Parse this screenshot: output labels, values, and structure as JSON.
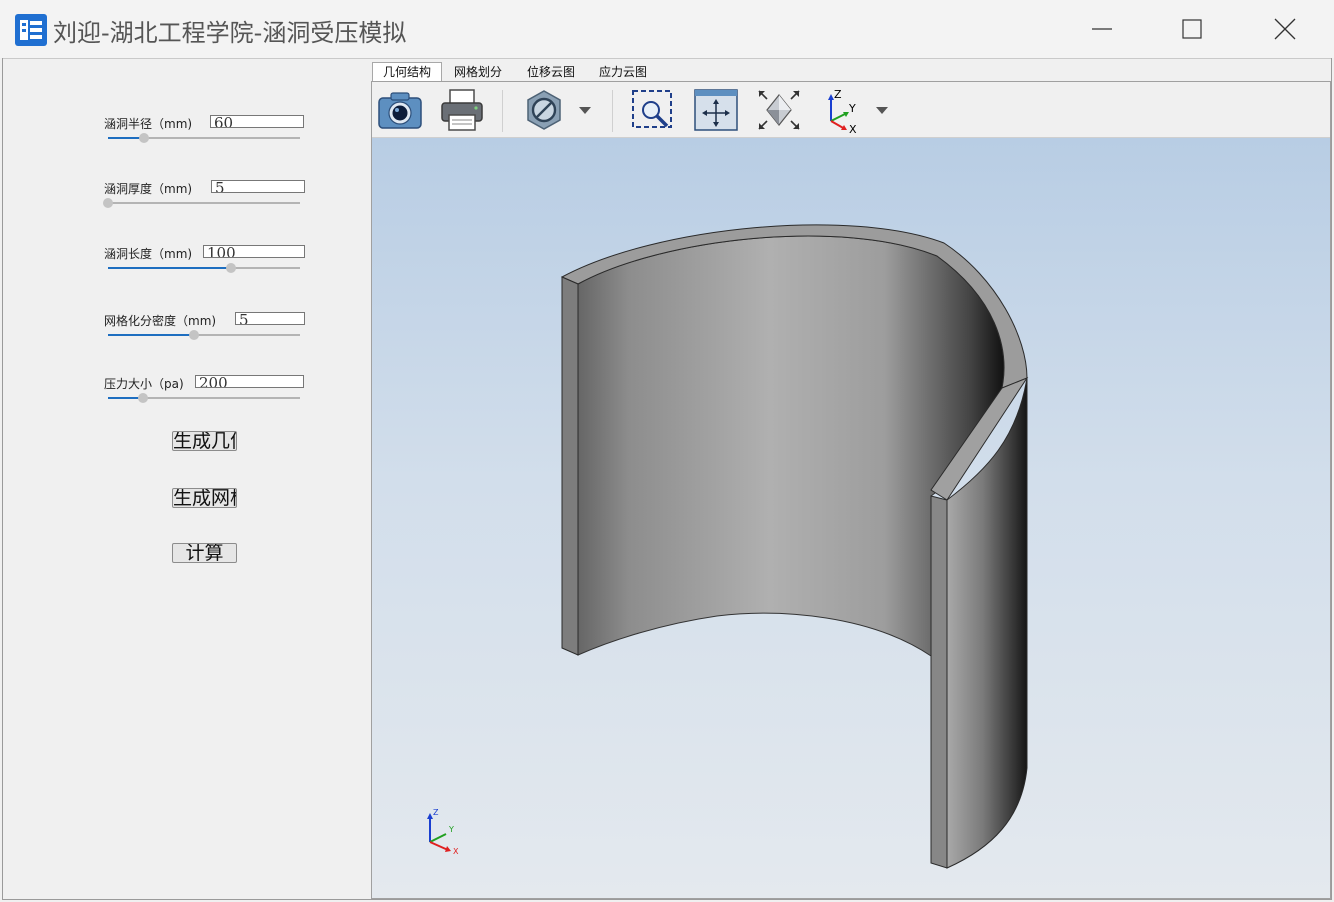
{
  "window": {
    "title": "刘迎-湖北工程学院-涵洞受压模拟"
  },
  "params": [
    {
      "label": "涵洞半径（mm)",
      "value": "60",
      "slider_fraction": 0.19
    },
    {
      "label": "涵洞厚度（mm)",
      "value": "5",
      "slider_fraction": 0.0
    },
    {
      "label": "涵洞长度（mm)",
      "value": "100",
      "slider_fraction": 0.64
    },
    {
      "label": "网格化分密度（mm)",
      "value": "5",
      "slider_fraction": 0.45
    },
    {
      "label": "压力大小（pa)",
      "value": "200",
      "slider_fraction": 0.18
    }
  ],
  "buttons": {
    "generate_geometry": "生成几何",
    "generate_mesh": "生成网格",
    "calculate": "计算"
  },
  "tabs": [
    {
      "label": "几何结构",
      "active": true
    },
    {
      "label": "网格划分",
      "active": false
    },
    {
      "label": "位移云图",
      "active": false
    },
    {
      "label": "应力云图",
      "active": false
    }
  ],
  "toolbar": [
    {
      "icon": "camera-icon"
    },
    {
      "icon": "printer-icon"
    },
    {
      "icon": "hide-icon"
    },
    {
      "icon": "zoom-window-icon"
    },
    {
      "icon": "fit-all-icon"
    },
    {
      "icon": "isometric-view-icon"
    },
    {
      "icon": "axes-view-icon"
    }
  ],
  "axes_labels": {
    "z": "Z",
    "y": "Y",
    "x": "X"
  },
  "colors": {
    "accent": "#1e6ec0",
    "viewport_top": "#b8cde4",
    "viewport_bottom": "#e4e9ee",
    "axis_x": "#e02020",
    "axis_y": "#20a020",
    "axis_z": "#1a3fd0"
  }
}
